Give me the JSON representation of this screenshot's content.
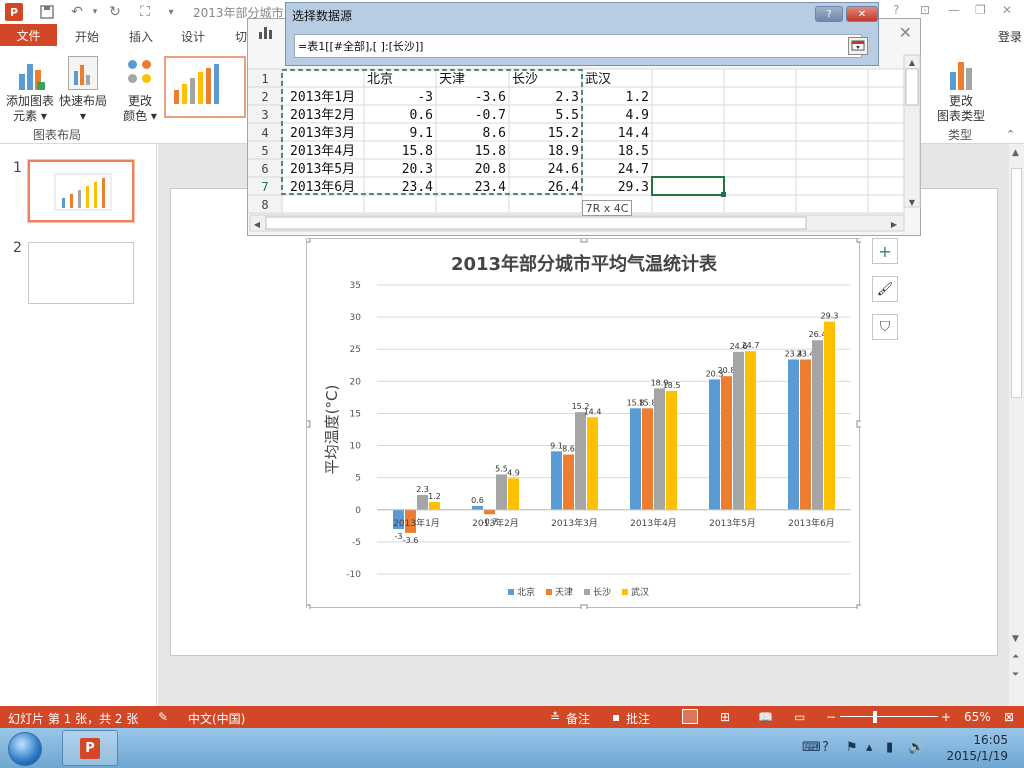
{
  "titlebar": {
    "app_logo": "P",
    "doc_title": "2013年部分城市"
  },
  "tabs": {
    "file": "文件",
    "items": [
      "开始",
      "插入",
      "设计",
      "切"
    ],
    "login": "登录"
  },
  "ribbon": {
    "add_element": [
      "添加图表",
      "元素 ▾"
    ],
    "quick_layout": [
      "快速布局",
      "▾"
    ],
    "change_color": [
      "更改",
      "颜色 ▾"
    ],
    "group_layout": "图表布局",
    "change_type": [
      "更改",
      "图表类型"
    ],
    "group_type": "类型"
  },
  "slides": {
    "numbers": [
      "1",
      "2"
    ]
  },
  "dialog": {
    "title": "选择数据源",
    "help": "?",
    "close": "✕",
    "range_value": "=表1[[#全部],[ ]:[长沙]]"
  },
  "sheet": {
    "close": "✕",
    "row_numbers": [
      "1",
      "2",
      "3",
      "4",
      "5",
      "6",
      "7",
      "8"
    ],
    "headers": [
      "",
      "北京",
      "天津",
      "长沙",
      "武汉"
    ],
    "rows": [
      [
        "2013年1月",
        "-3",
        "-3.6",
        "2.3",
        "1.2"
      ],
      [
        "2013年2月",
        "0.6",
        "-0.7",
        "5.5",
        "4.9"
      ],
      [
        "2013年3月",
        "9.1",
        "8.6",
        "15.2",
        "14.4"
      ],
      [
        "2013年4月",
        "15.8",
        "15.8",
        "18.9",
        "18.5"
      ],
      [
        "2013年5月",
        "20.3",
        "20.8",
        "24.6",
        "24.7"
      ],
      [
        "2013年6月",
        "23.4",
        "23.4",
        "26.4",
        "29.3"
      ]
    ],
    "dim_tip": "7R x 4C"
  },
  "chart_data": {
    "type": "bar",
    "title": "2013年部分城市平均气温统计表",
    "ylabel": "平均温度(°C)",
    "xlabel": "",
    "ylim": [
      -10,
      35
    ],
    "yticks": [
      35,
      30,
      25,
      20,
      15,
      10,
      5,
      0,
      -5,
      -10
    ],
    "categories": [
      "2013年1月",
      "2013年2月",
      "2013年3月",
      "2013年4月",
      "2013年5月",
      "2013年6月"
    ],
    "series": [
      {
        "name": "北京",
        "color": "#5b9bd5",
        "values": [
          -3,
          0.6,
          9.1,
          15.8,
          20.3,
          23.4
        ]
      },
      {
        "name": "天津",
        "color": "#ed7d31",
        "values": [
          -3.6,
          -0.7,
          8.6,
          15.8,
          20.8,
          23.4
        ]
      },
      {
        "name": "长沙",
        "color": "#a5a5a5",
        "values": [
          2.3,
          5.5,
          15.2,
          18.9,
          24.6,
          26.4
        ]
      },
      {
        "name": "武汉",
        "color": "#ffc000",
        "values": [
          1.2,
          4.9,
          14.4,
          18.5,
          24.7,
          29.3
        ]
      }
    ],
    "legend_position": "bottom",
    "grid": true
  },
  "chart_side_buttons": {
    "add": "+",
    "style": "🖌",
    "filter": "⛉"
  },
  "statusbar": {
    "slide_info": "幻灯片 第 1 张，共 2 张",
    "language": "中文(中国)",
    "notes": "备注",
    "comments": "批注",
    "zoom_minus": "−",
    "zoom_plus": "+",
    "zoom_percent": "65%",
    "zoom_level": 0.65
  },
  "taskbar": {
    "pp": "P",
    "time": "16:05",
    "date": "2015/1/19"
  },
  "colors": {
    "accent": "#d24726",
    "dialog_bg": "#b8cde4",
    "selection": "#217346"
  }
}
